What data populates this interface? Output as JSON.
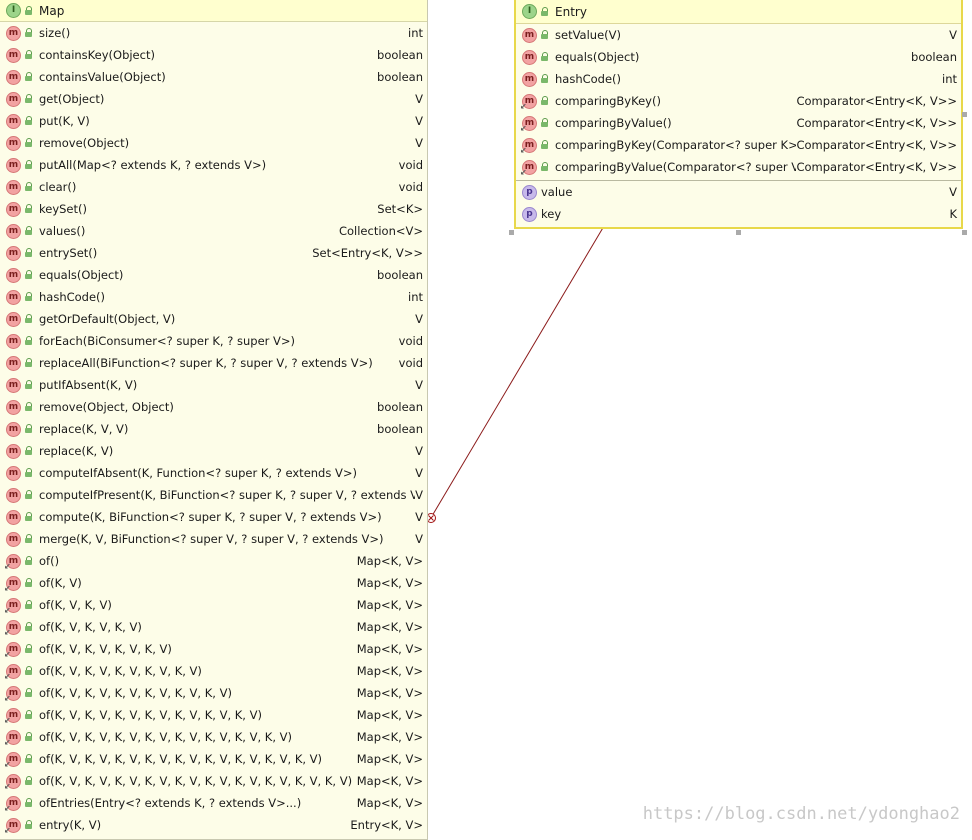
{
  "map": {
    "title": "Map",
    "methods": [
      {
        "name": "size()",
        "type": "int",
        "static": false
      },
      {
        "name": "containsKey(Object)",
        "type": "boolean",
        "static": false
      },
      {
        "name": "containsValue(Object)",
        "type": "boolean",
        "static": false
      },
      {
        "name": "get(Object)",
        "type": "V",
        "static": false
      },
      {
        "name": "put(K, V)",
        "type": "V",
        "static": false
      },
      {
        "name": "remove(Object)",
        "type": "V",
        "static": false
      },
      {
        "name": "putAll(Map<? extends K, ? extends V>)",
        "type": "void",
        "static": false
      },
      {
        "name": "clear()",
        "type": "void",
        "static": false
      },
      {
        "name": "keySet()",
        "type": "Set<K>",
        "static": false
      },
      {
        "name": "values()",
        "type": "Collection<V>",
        "static": false
      },
      {
        "name": "entrySet()",
        "type": "Set<Entry<K, V>>",
        "static": false
      },
      {
        "name": "equals(Object)",
        "type": "boolean",
        "static": false
      },
      {
        "name": "hashCode()",
        "type": "int",
        "static": false
      },
      {
        "name": "getOrDefault(Object, V)",
        "type": "V",
        "static": false
      },
      {
        "name": "forEach(BiConsumer<? super K, ? super V>)",
        "type": "void",
        "static": false
      },
      {
        "name": "replaceAll(BiFunction<? super K, ? super V, ? extends V>)",
        "type": "void",
        "static": false
      },
      {
        "name": "putIfAbsent(K, V)",
        "type": "V",
        "static": false
      },
      {
        "name": "remove(Object, Object)",
        "type": "boolean",
        "static": false
      },
      {
        "name": "replace(K, V, V)",
        "type": "boolean",
        "static": false
      },
      {
        "name": "replace(K, V)",
        "type": "V",
        "static": false
      },
      {
        "name": "computeIfAbsent(K, Function<? super K, ? extends V>)",
        "type": "V",
        "static": false
      },
      {
        "name": "computeIfPresent(K, BiFunction<? super K, ? super V, ? extends V>)",
        "type": "V",
        "static": false
      },
      {
        "name": "compute(K, BiFunction<? super K, ? super V, ? extends V>)",
        "type": "V",
        "static": false
      },
      {
        "name": "merge(K, V, BiFunction<? super V, ? super V, ? extends V>)",
        "type": "V",
        "static": false
      },
      {
        "name": "of()",
        "type": "Map<K, V>",
        "static": true
      },
      {
        "name": "of(K, V)",
        "type": "Map<K, V>",
        "static": true
      },
      {
        "name": "of(K, V, K, V)",
        "type": "Map<K, V>",
        "static": true
      },
      {
        "name": "of(K, V, K, V, K, V)",
        "type": "Map<K, V>",
        "static": true
      },
      {
        "name": "of(K, V, K, V, K, V, K, V)",
        "type": "Map<K, V>",
        "static": true
      },
      {
        "name": "of(K, V, K, V, K, V, K, V, K, V)",
        "type": "Map<K, V>",
        "static": true
      },
      {
        "name": "of(K, V, K, V, K, V, K, V, K, V, K, V)",
        "type": "Map<K, V>",
        "static": true
      },
      {
        "name": "of(K, V, K, V, K, V, K, V, K, V, K, V, K, V)",
        "type": "Map<K, V>",
        "static": true
      },
      {
        "name": "of(K, V, K, V, K, V, K, V, K, V, K, V, K, V, K, V)",
        "type": "Map<K, V>",
        "static": true
      },
      {
        "name": "of(K, V, K, V, K, V, K, V, K, V, K, V, K, V, K, V, K, V)",
        "type": "Map<K, V>",
        "static": true
      },
      {
        "name": "of(K, V, K, V, K, V, K, V, K, V, K, V, K, V, K, V, K, V, K, V)",
        "type": "Map<K, V>",
        "static": true
      },
      {
        "name": "ofEntries(Entry<? extends K, ? extends V>...)",
        "type": "Map<K, V>",
        "static": true
      },
      {
        "name": "entry(K, V)",
        "type": "Entry<K, V>",
        "static": true
      }
    ]
  },
  "entry": {
    "title": "Entry",
    "methods": [
      {
        "name": "setValue(V)",
        "type": "V",
        "static": false
      },
      {
        "name": "equals(Object)",
        "type": "boolean",
        "static": false
      },
      {
        "name": "hashCode()",
        "type": "int",
        "static": false
      },
      {
        "name": "comparingByKey()",
        "type": "Comparator<Entry<K, V>>",
        "static": true
      },
      {
        "name": "comparingByValue()",
        "type": "Comparator<Entry<K, V>>",
        "static": true
      },
      {
        "name": "comparingByKey(Comparator<? super K>)",
        "type": "Comparator<Entry<K, V>>",
        "static": true
      },
      {
        "name": "comparingByValue(Comparator<? super V>)",
        "type": "Comparator<Entry<K, V>>",
        "static": true
      }
    ],
    "fields": [
      {
        "name": "value",
        "type": "V"
      },
      {
        "name": "key",
        "type": "K"
      }
    ]
  },
  "icons": {
    "interface": "I",
    "method": "m",
    "property": "p"
  },
  "watermark": "https://blog.csdn.net/ydonghao2",
  "colors": {
    "class_bg": "#fdfde8",
    "selected_border": "#e8d84a",
    "connector": "#8b1a1a"
  }
}
